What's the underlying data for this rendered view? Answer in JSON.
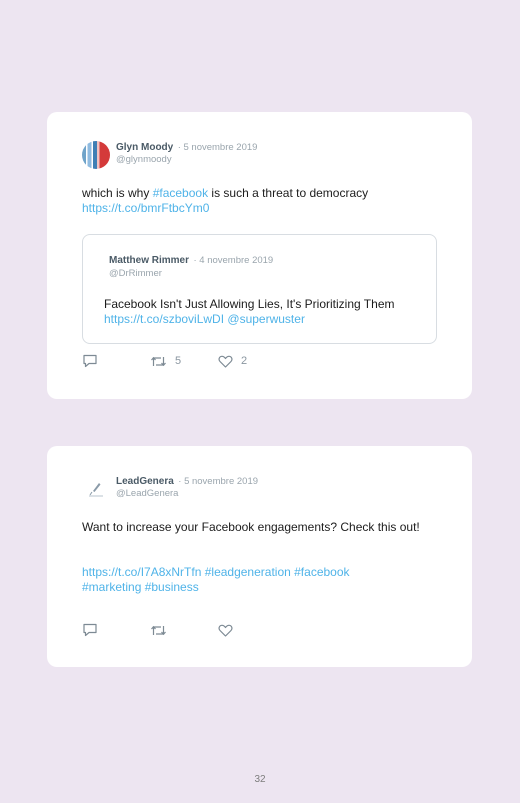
{
  "posts": [
    {
      "author": "Glyn Moody",
      "date": "· 5 novembre 2019",
      "handle": "@glynmoody",
      "text_plain_1": "which is why ",
      "hashtag_1": "#facebook",
      "text_plain_2": " is such a threat to democracy",
      "link": "https://t.co/bmrFtbcYm0",
      "quote": {
        "author": "Matthew Rimmer",
        "date": "· 4 novembre 2019",
        "handle": "@DrRimmer",
        "text": "Facebook Isn't Just Allowing Lies, It's Prioritizing Them ",
        "link": "https://t.co/szboviLwDI",
        "mention": "@superwuster"
      },
      "retweets": "5",
      "likes": "2"
    },
    {
      "author": "LeadGenera",
      "date": "· 5 novembre 2019",
      "handle": "@LeadGenera",
      "text": "Want to increase your Facebook engagements? Check this out!",
      "link": "https://t.co/I7A8xNrTfn",
      "hashtags_line1": " #leadgeneration #facebook",
      "hashtags_line2": "#marketing #business"
    }
  ],
  "icons": {
    "reply": "reply-icon",
    "retweet": "retweet-icon",
    "like": "heart-icon"
  },
  "colors": {
    "background": "#ede5f1",
    "link": "#4fb3e8"
  },
  "page_number": "32"
}
